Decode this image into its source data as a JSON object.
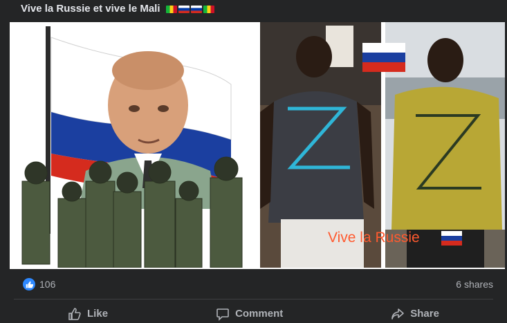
{
  "post": {
    "caption": "Vive la Russie et vive le Mali",
    "caption_flags": [
      "mali-flag",
      "russia-flag",
      "russia-flag",
      "mali-flag"
    ]
  },
  "media": {
    "right_overlay_text": "Vive la Russie",
    "accent_colors": {
      "russia_white": "#ffffff",
      "russia_blue": "#0039a6",
      "russia_red": "#d52b1e",
      "mali_green": "#14b53a",
      "mali_yellow": "#fcd116",
      "mali_red": "#ce1126"
    }
  },
  "stats": {
    "like_count": "106",
    "shares": "6 shares"
  },
  "actions": {
    "like_label": "Like",
    "comment_label": "Comment",
    "share_label": "Share"
  },
  "theme": {
    "background": "#242526",
    "text": "#e4e6eb",
    "muted": "#b0b3b8",
    "like_blue": "#2d88ff"
  }
}
